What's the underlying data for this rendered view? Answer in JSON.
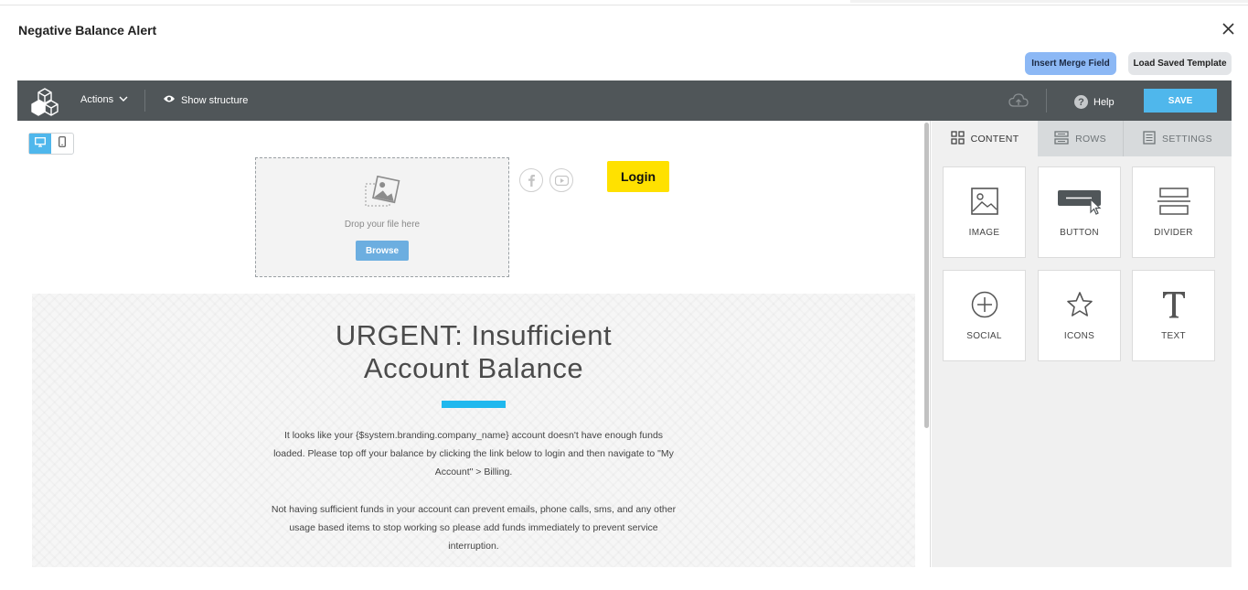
{
  "modal": {
    "title": "Negative Balance Alert",
    "buttons": {
      "insert_merge_field": "Insert Merge Field",
      "load_saved_template": "Load Saved Template"
    }
  },
  "toolbar": {
    "actions_label": "Actions",
    "show_structure_label": "Show structure",
    "help_label": "Help",
    "help_glyph": "?",
    "save_label": "SAVE"
  },
  "canvas": {
    "dropzone": {
      "text": "Drop your file here",
      "browse_label": "Browse"
    },
    "login_label": "Login",
    "headline_line1": "URGENT: Insufficient",
    "headline_line2": "Account Balance",
    "paragraph1": "It looks like your {$system.branding.company_name} account doesn't have enough funds loaded. Please top off your balance by clicking the link below to login and then navigate to \"My Account\" > Billing.",
    "paragraph2": "Not having sufficient funds in your account can prevent emails, phone calls, sms, and any other usage based items to stop working so please add funds immediately to prevent service interruption.",
    "accent_color": "#1fb8ee",
    "login_color": "#ffe100"
  },
  "panel": {
    "tabs": [
      {
        "label": "CONTENT",
        "icon": "grid-icon",
        "active": true
      },
      {
        "label": "ROWS",
        "icon": "rows-icon",
        "active": false
      },
      {
        "label": "SETTINGS",
        "icon": "settings-doc-icon",
        "active": false
      }
    ],
    "tiles": [
      {
        "label": "IMAGE",
        "icon": "image-icon"
      },
      {
        "label": "BUTTON",
        "icon": "button-icon"
      },
      {
        "label": "DIVIDER",
        "icon": "divider-icon"
      },
      {
        "label": "SOCIAL",
        "icon": "social-plus-icon"
      },
      {
        "label": "ICONS",
        "icon": "star-icon"
      },
      {
        "label": "TEXT",
        "icon": "text-t-icon"
      }
    ]
  },
  "colors": {
    "toolbar_bg": "#505659",
    "save_button": "#4fb7ec",
    "merge_button": "#8cb8f5"
  }
}
